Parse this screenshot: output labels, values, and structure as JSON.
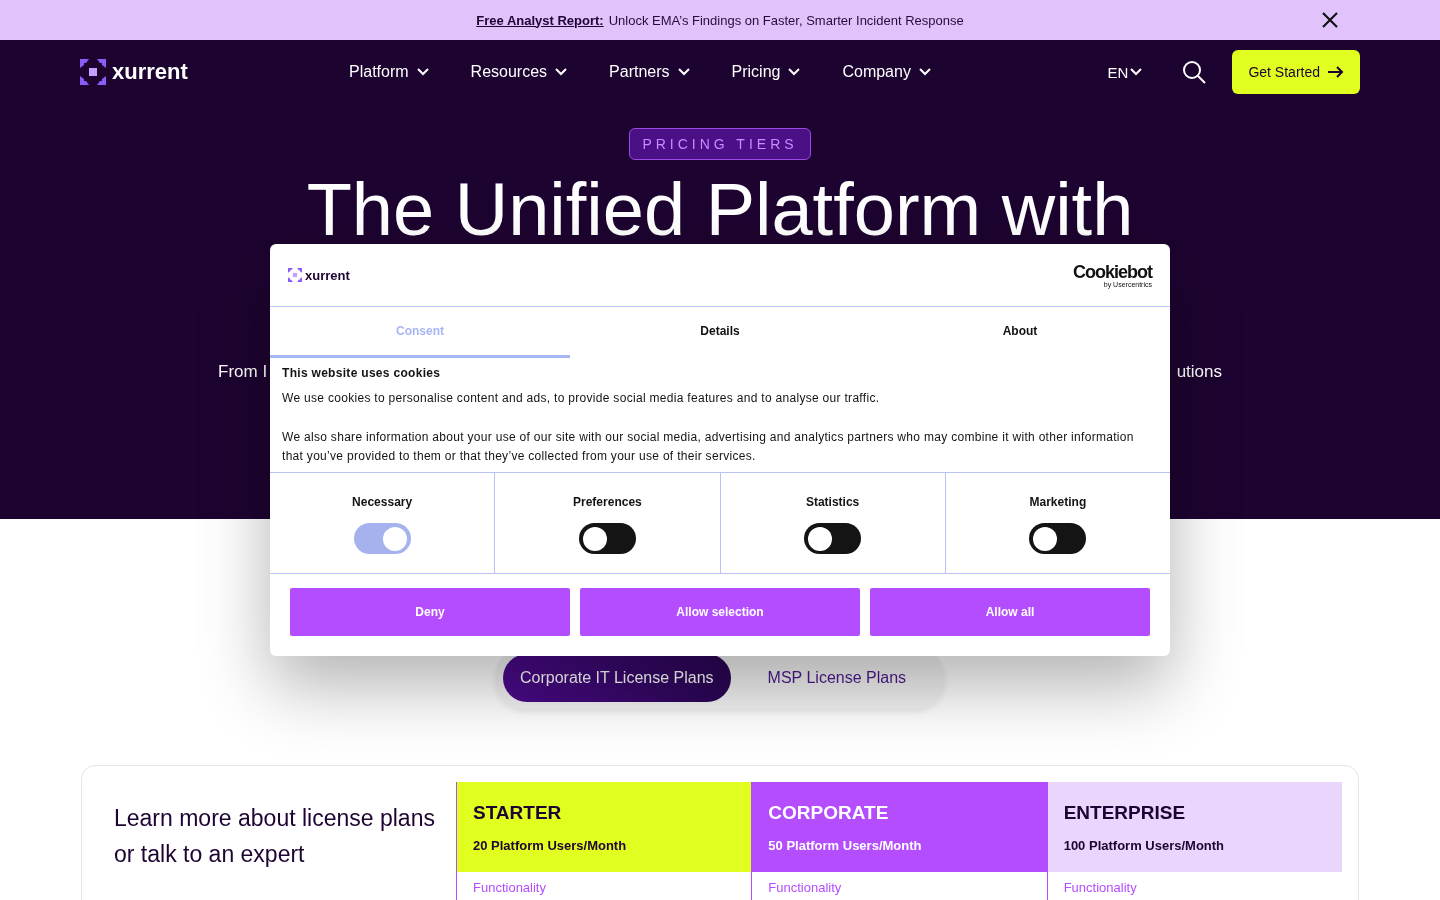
{
  "announcement": {
    "link": "Free Analyst Report:",
    "text": "Unlock EMA’s Findings on Faster, Smarter Incident Response"
  },
  "nav": {
    "logo": "xurrent",
    "items": [
      {
        "label": "Platform"
      },
      {
        "label": "Resources"
      },
      {
        "label": "Partners"
      },
      {
        "label": "Pricing"
      },
      {
        "label": "Company"
      }
    ],
    "language": "EN",
    "cta": "Get Started"
  },
  "hero": {
    "badge": "PRICING TIERS",
    "heading": "The Unified Platform with",
    "subtitle_left": "From I",
    "subtitle_right": "utions"
  },
  "plan_tabs": [
    {
      "label": "Corporate IT License Plans",
      "selected": true
    },
    {
      "label": "MSP License Plans",
      "selected": false
    }
  ],
  "plans": {
    "intro": "Learn more about license plans or talk to an expert",
    "tiers": [
      {
        "name": "STARTER",
        "users": "20 Platform Users/Month",
        "feature": "Functionality",
        "color": "#e0ff20"
      },
      {
        "name": "CORPORATE",
        "users": "50 Platform Users/Month",
        "feature": "Functionality",
        "color": "#b44dfe"
      },
      {
        "name": "ENTERPRISE",
        "users": "100 Platform Users/Month",
        "feature": "Functionality",
        "color": "#ead6fc"
      }
    ]
  },
  "cookie_dialog": {
    "logo": "xurrent",
    "brand": "Cookiebot",
    "brand_sub": "by Usercentrics",
    "tabs": [
      {
        "label": "Consent",
        "selected": true
      },
      {
        "label": "Details",
        "selected": false
      },
      {
        "label": "About",
        "selected": false
      }
    ],
    "title": "This website uses cookies",
    "paragraphs": [
      "We use cookies to personalise content and ads, to provide social media features and to analyse our traffic.",
      "We also share information about your use of our site with our social media, advertising and analytics partners who may combine it with other information that you’ve provided to them or that they’ve collected from your use of their services."
    ],
    "categories": [
      {
        "label": "Necessary",
        "on": true,
        "disabled": true
      },
      {
        "label": "Preferences",
        "on": false,
        "disabled": false
      },
      {
        "label": "Statistics",
        "on": false,
        "disabled": false
      },
      {
        "label": "Marketing",
        "on": false,
        "disabled": false
      }
    ],
    "buttons": [
      "Deny",
      "Allow selection",
      "Allow all"
    ]
  }
}
